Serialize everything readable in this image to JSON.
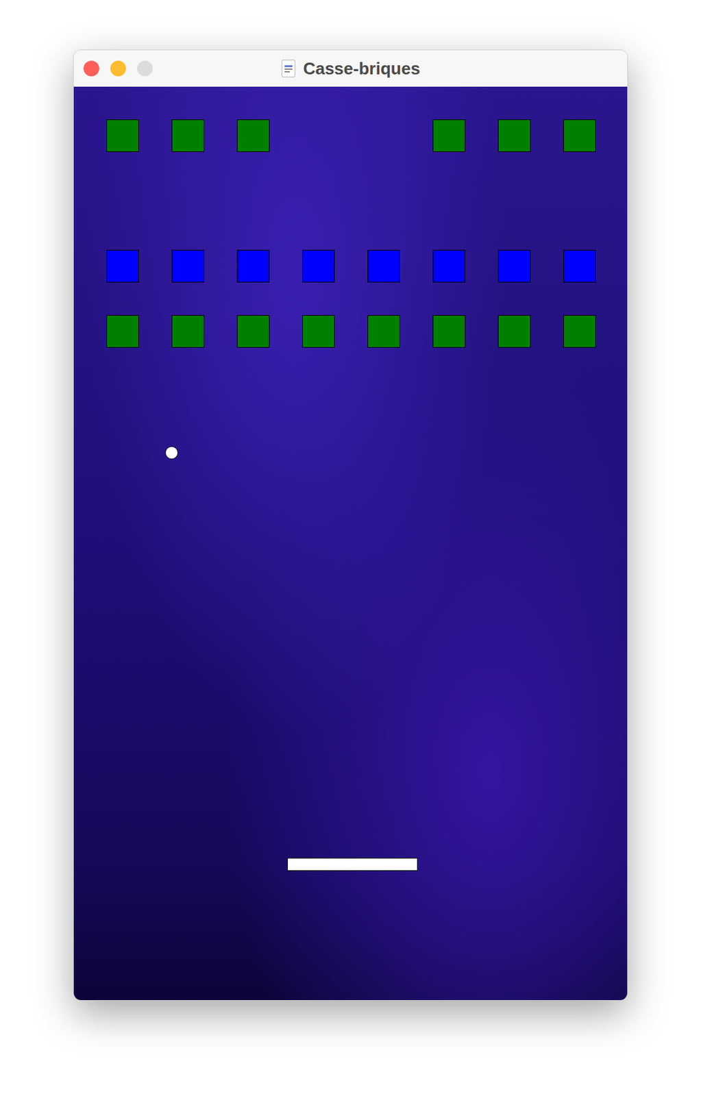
{
  "window": {
    "title": "Casse-briques"
  },
  "bricks": [
    [
      {
        "present": true,
        "color": "#008000"
      },
      {
        "present": true,
        "color": "#008000"
      },
      {
        "present": true,
        "color": "#008000"
      },
      {
        "present": false,
        "color": "#008000"
      },
      {
        "present": false,
        "color": "#008000"
      },
      {
        "present": true,
        "color": "#008000"
      },
      {
        "present": true,
        "color": "#008000"
      },
      {
        "present": true,
        "color": "#008000"
      }
    ],
    [
      {
        "present": false,
        "color": "#ff0000"
      },
      {
        "present": false,
        "color": "#ff0000"
      },
      {
        "present": false,
        "color": "#ff0000"
      },
      {
        "present": false,
        "color": "#ff0000"
      },
      {
        "present": false,
        "color": "#ff0000"
      },
      {
        "present": false,
        "color": "#ff0000"
      },
      {
        "present": false,
        "color": "#ff0000"
      },
      {
        "present": false,
        "color": "#ff0000"
      }
    ],
    [
      {
        "present": true,
        "color": "#0000ff"
      },
      {
        "present": true,
        "color": "#0000ff"
      },
      {
        "present": true,
        "color": "#0000ff"
      },
      {
        "present": true,
        "color": "#0000ff"
      },
      {
        "present": true,
        "color": "#0000ff"
      },
      {
        "present": true,
        "color": "#0000ff"
      },
      {
        "present": true,
        "color": "#0000ff"
      },
      {
        "present": true,
        "color": "#0000ff"
      }
    ],
    [
      {
        "present": true,
        "color": "#008000"
      },
      {
        "present": true,
        "color": "#008000"
      },
      {
        "present": true,
        "color": "#008000"
      },
      {
        "present": true,
        "color": "#008000"
      },
      {
        "present": true,
        "color": "#008000"
      },
      {
        "present": true,
        "color": "#008000"
      },
      {
        "present": true,
        "color": "#008000"
      },
      {
        "present": true,
        "color": "#008000"
      }
    ]
  ]
}
